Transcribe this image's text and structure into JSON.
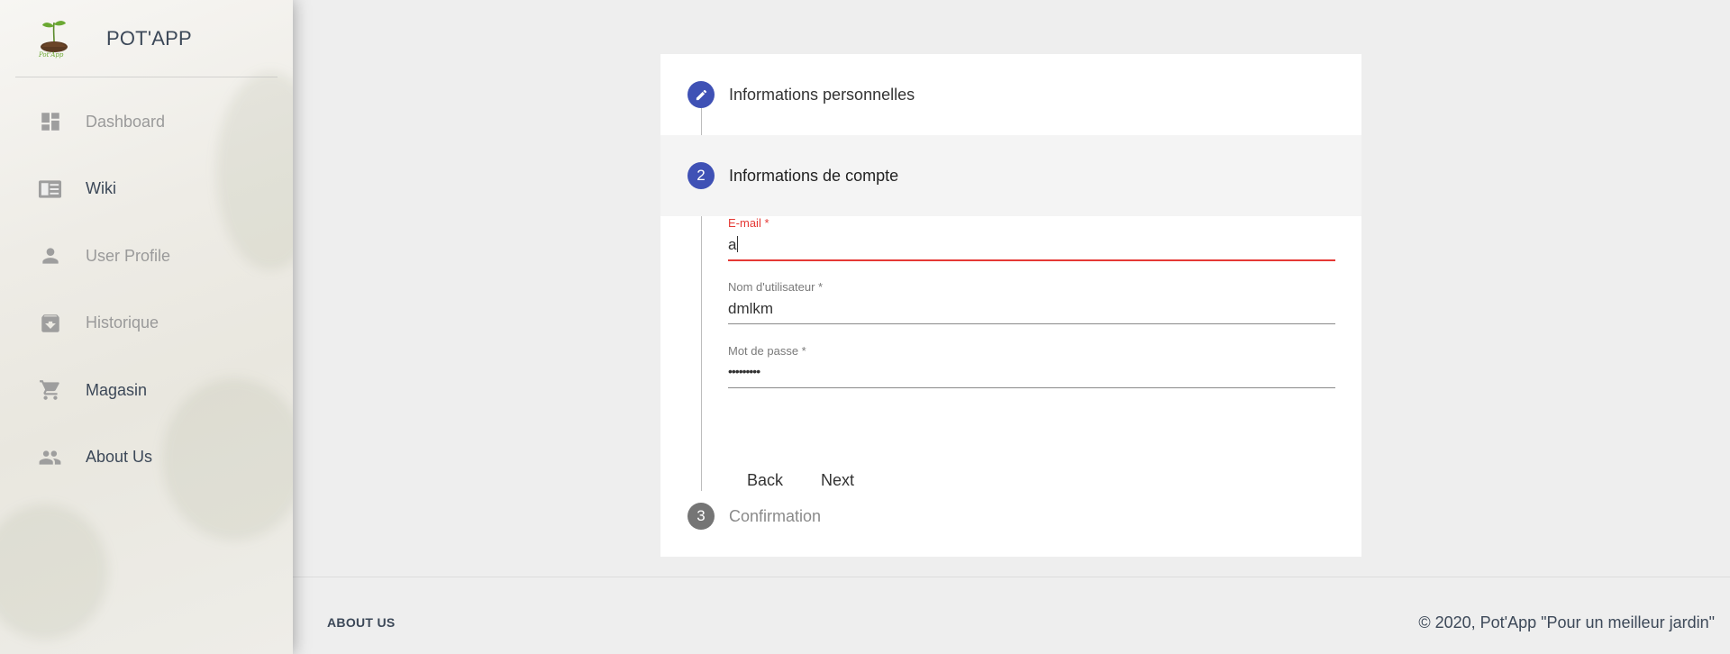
{
  "brand": {
    "name": "POT'APP",
    "logo_text": "Pot'App"
  },
  "sidebar": {
    "items": [
      {
        "label": "Dashboard",
        "icon": "dashboard-icon"
      },
      {
        "label": "Wiki",
        "icon": "wiki-icon"
      },
      {
        "label": "User Profile",
        "icon": "person-icon"
      },
      {
        "label": "Historique",
        "icon": "archive-icon"
      },
      {
        "label": "Magasin",
        "icon": "cart-icon"
      },
      {
        "label": "About Us",
        "icon": "people-icon"
      }
    ]
  },
  "stepper": {
    "steps": [
      {
        "number": "",
        "title": "Informations personnelles",
        "state": "completed",
        "icon": "pencil-icon"
      },
      {
        "number": "2",
        "title": "Informations de compte",
        "state": "active"
      },
      {
        "number": "3",
        "title": "Confirmation",
        "state": "pending"
      }
    ],
    "fields": {
      "email": {
        "label": "E-mail *",
        "value": "a"
      },
      "username": {
        "label": "Nom d'utilisateur *",
        "value": "dmlkm"
      },
      "password": {
        "label": "Mot de passe *",
        "value": "•••••••••"
      }
    },
    "buttons": {
      "back": "Back",
      "next": "Next"
    }
  },
  "footer": {
    "link": "ABOUT US",
    "copyright": "© 2020, Pot'App \"Pour un meilleur jardin\""
  },
  "colors": {
    "primary": "#3f51b5",
    "error": "#e53935",
    "pending": "#757575"
  }
}
